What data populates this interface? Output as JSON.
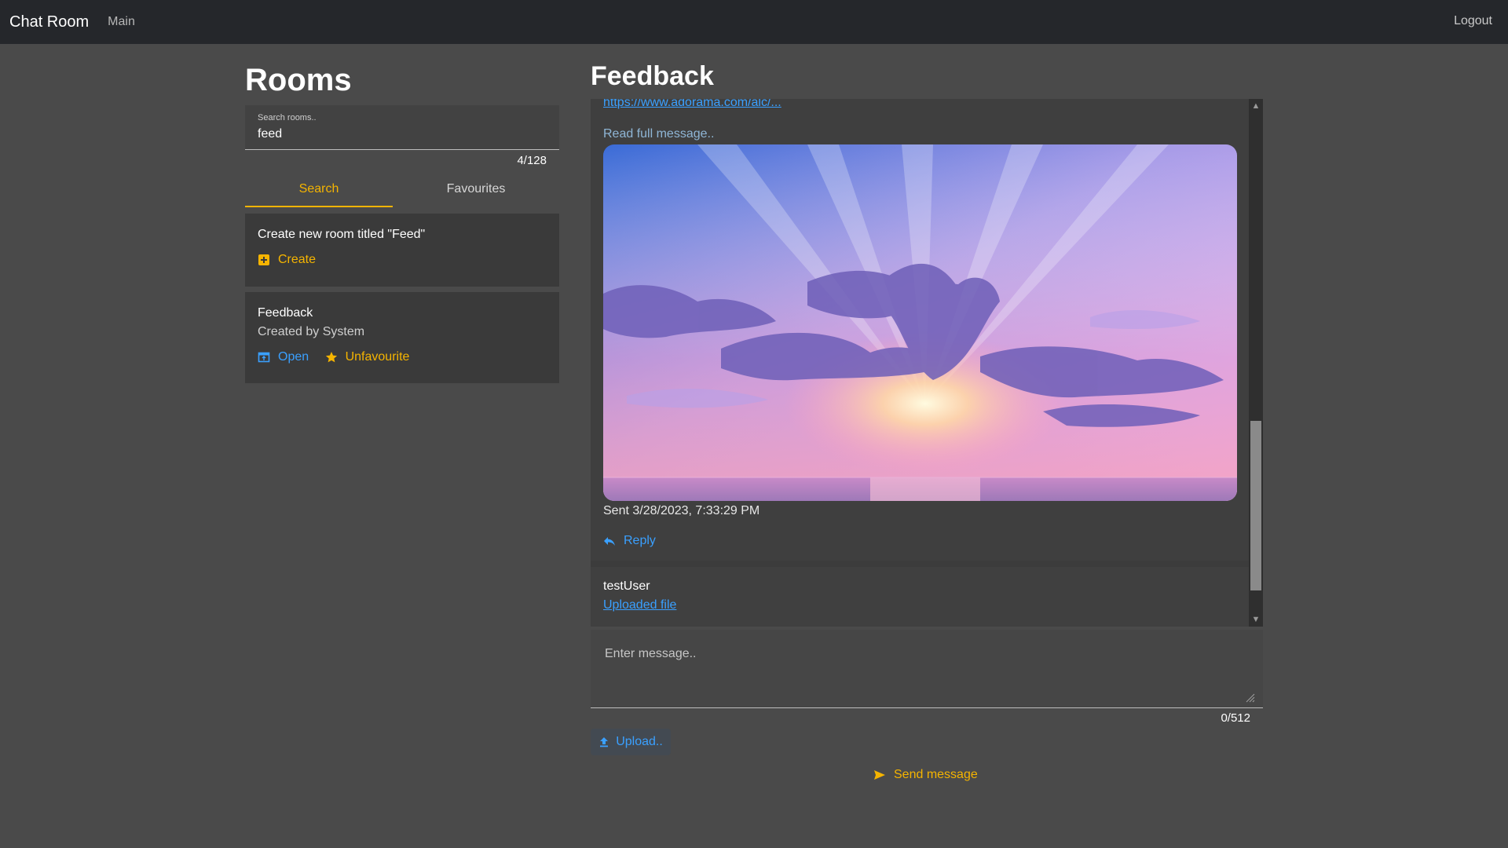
{
  "navbar": {
    "brand": "Chat Room",
    "main_link": "Main",
    "logout": "Logout"
  },
  "sidebar": {
    "title": "Rooms",
    "search": {
      "label": "Search rooms..",
      "value": "feed",
      "count": "4/128"
    },
    "tabs": [
      {
        "label": "Search",
        "active": true
      },
      {
        "label": "Favourites",
        "active": false
      }
    ],
    "create_card": {
      "title": "Create new room titled \"Feed\"",
      "action": "Create"
    },
    "rooms": [
      {
        "name": "Feedback",
        "creator": "Created by System",
        "open": "Open",
        "favourite_action": "Unfavourite"
      }
    ]
  },
  "room": {
    "title": "Feedback",
    "messages": [
      {
        "link": "https://www.adorama.com/alc/...",
        "read_full": "Read full message..",
        "image_icon": "sunset-photo",
        "sent": "Sent 3/28/2023, 7:33:29 PM",
        "reply": "Reply"
      },
      {
        "user": "testUser",
        "link": "Uploaded file"
      }
    ],
    "composer": {
      "placeholder": "Enter message..",
      "count": "0/512"
    },
    "upload": "Upload..",
    "send": "Send message"
  },
  "colors": {
    "accent": "#f5b400",
    "link": "#3aa0ff",
    "navbar": "#25272b",
    "background": "#4a4a4a"
  }
}
